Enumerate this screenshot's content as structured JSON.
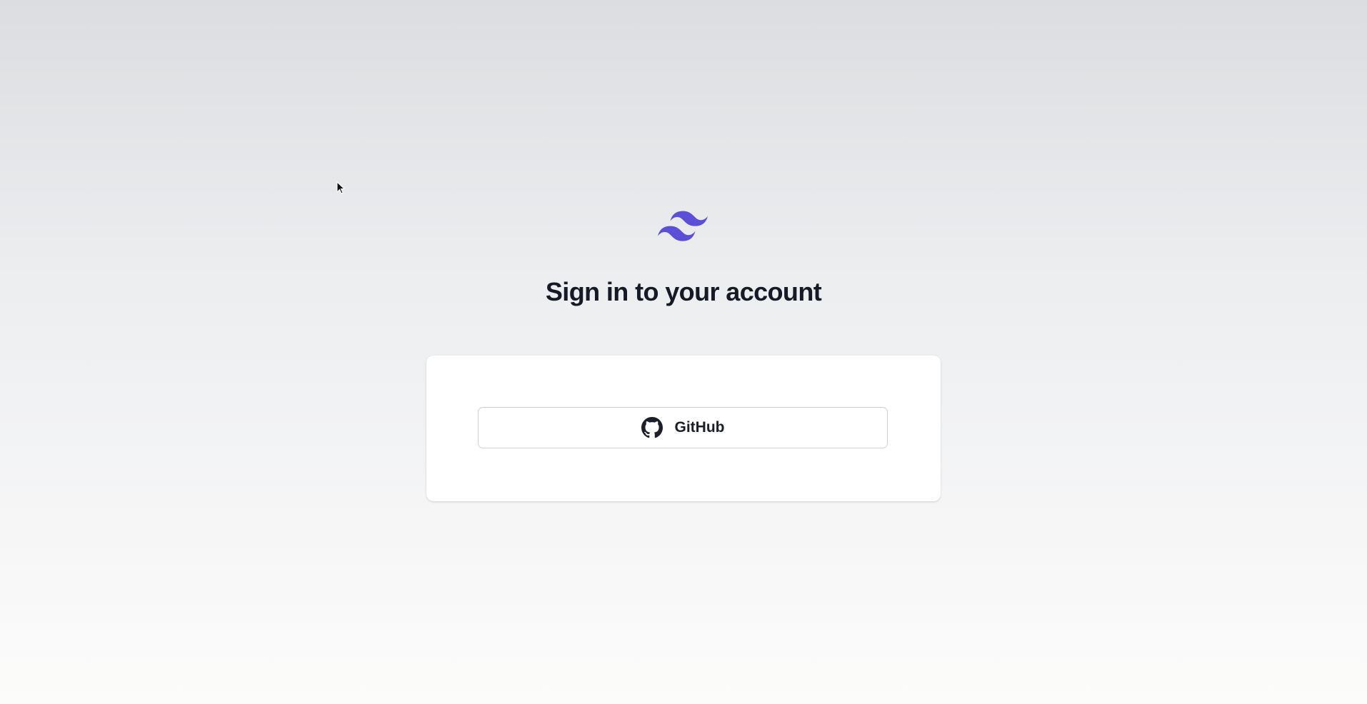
{
  "header": {
    "logo_icon": "tailwind-logo-icon",
    "title": "Sign in to your account"
  },
  "card": {
    "github_button": {
      "icon": "github-icon",
      "label": "GitHub"
    }
  },
  "colors": {
    "brand": "#5b4fd8",
    "title": "#161a26",
    "button_border": "#cfd1d5"
  }
}
